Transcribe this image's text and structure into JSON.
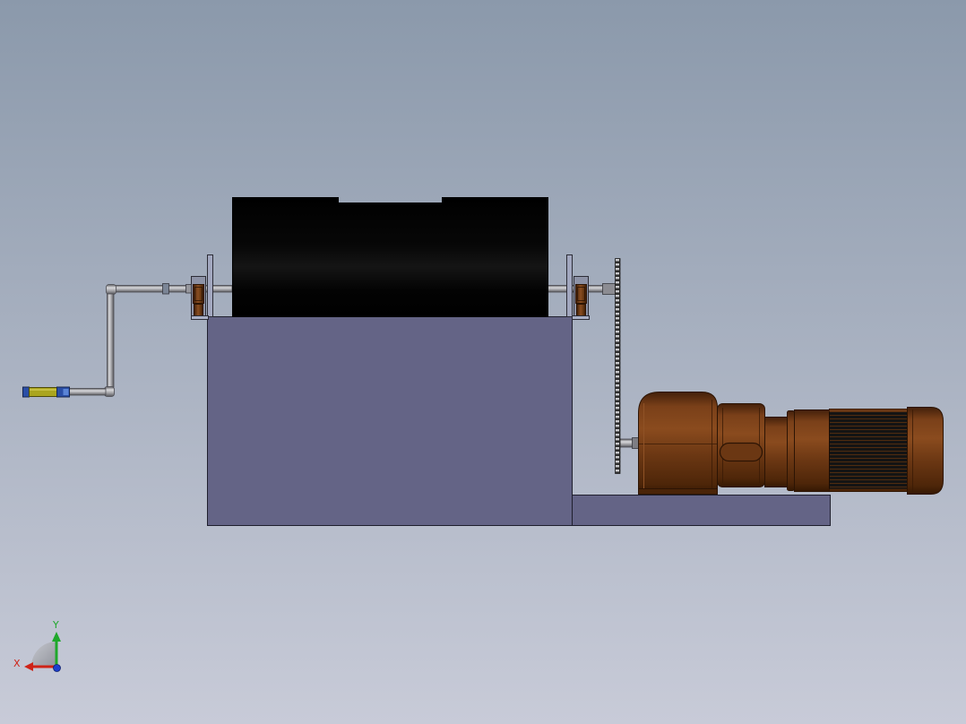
{
  "viewport": {
    "background_top": "#8b99ab",
    "background_bottom": "#c8cbd8"
  },
  "model": {
    "drum": "#030303",
    "frame": "#646486",
    "side_plates": "#a2a7bf",
    "bearings": "#6a3a14",
    "pipe": "#a6a6aa",
    "grip": "#aaa51f",
    "grip_ends": "#2a4ea6",
    "chain": "#2e2e2e",
    "gear_motor": "#6b3713",
    "motor_fins": "#141414"
  },
  "triad": {
    "icon": "axis-triad-icon",
    "x_label": "X",
    "y_label": "Y",
    "x_color": "#cf2317",
    "y_color": "#1fa82b",
    "z_color": "#1d3fcf"
  }
}
